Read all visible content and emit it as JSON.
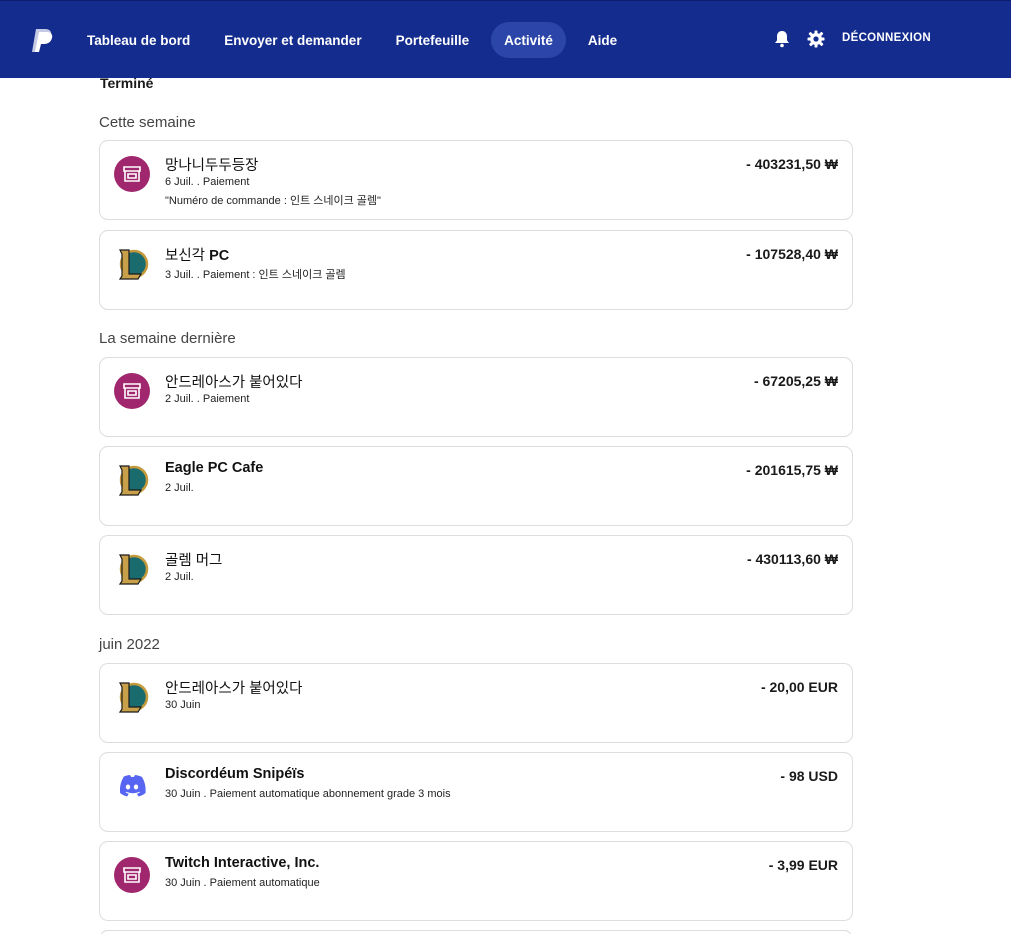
{
  "header": {
    "nav": [
      {
        "label": "Tableau de bord"
      },
      {
        "label": "Envoyer et demander"
      },
      {
        "label": "Portefeuille"
      },
      {
        "label": "Activité"
      },
      {
        "label": "Aide"
      }
    ],
    "active_nav": "Activité",
    "logout_label": "DÉCONNEXION",
    "colors": {
      "bar": "#142c8e",
      "active_pill": "#2b46a8"
    }
  },
  "status_heading": "Terminé",
  "sections": [
    {
      "title": "Cette semaine",
      "items": [
        {
          "icon": "shop-icon",
          "name": "망나니두두등장",
          "bold": false,
          "sub": "6 Juil. . Paiement",
          "sub2": "\"Numéro de commande : 인트 스네이크 골렘\"",
          "amount": "- 403231,50 ₩"
        },
        {
          "icon": "league-of-legends-icon",
          "name": "보신각 PC",
          "bold": false,
          "sub": "3 Juil. . Paiement : 인트 스네이크 골렘",
          "sub2": "",
          "amount": "- 107528,40  ₩"
        }
      ]
    },
    {
      "title": "La semaine dernière",
      "items": [
        {
          "icon": "shop-icon",
          "name": "안드레아스가 붙어있다",
          "bold": false,
          "sub": "2 Juil. . Paiement",
          "sub2": "",
          "amount": "- 67205,25 ₩"
        },
        {
          "icon": "league-of-legends-icon",
          "name": "Eagle PC Cafe",
          "bold": true,
          "sub": "2 Juil.",
          "sub2": "",
          "amount": "- 201615,75 ₩"
        },
        {
          "icon": "league-of-legends-icon",
          "name": "골렘 머그",
          "bold": false,
          "sub": "2 Juil.",
          "sub2": "",
          "amount": "- 430113,60 ₩"
        }
      ]
    },
    {
      "title": "juin 2022",
      "items": [
        {
          "icon": "league-of-legends-icon",
          "name": "안드레아스가 붙어있다",
          "bold": false,
          "sub": "30 Juin",
          "sub2": "",
          "amount": "- 20,00 EUR"
        },
        {
          "icon": "discord-icon",
          "name": "Discordéum Snipéïs",
          "bold": true,
          "sub": "30 Juin . Paiement automatique abonnement grade 3 mois",
          "sub2": "",
          "amount": "- 98 USD"
        },
        {
          "icon": "shop-icon",
          "name": "Twitch Interactive, Inc.",
          "bold": true,
          "sub": "30 Juin . Paiement automatique",
          "sub2": "",
          "amount": "- 3,99 EUR"
        }
      ]
    }
  ]
}
